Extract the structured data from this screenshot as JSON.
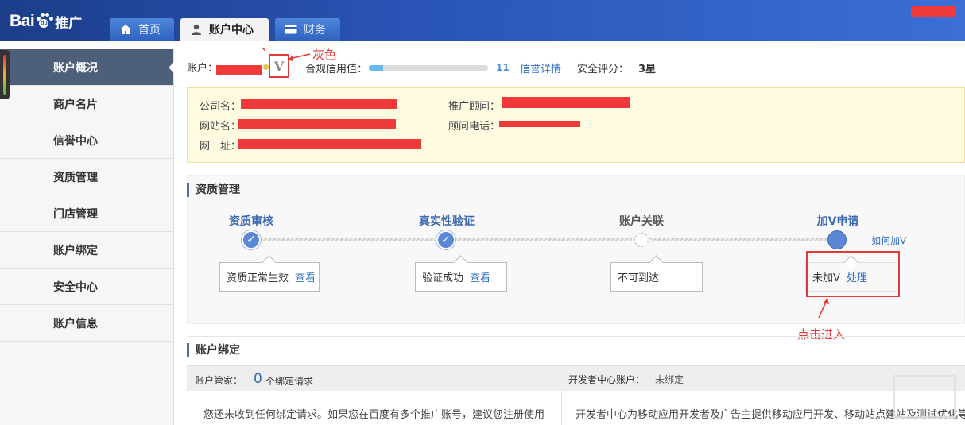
{
  "logo": {
    "bai": "Bai",
    "du": "du",
    "tuiguang": "推广"
  },
  "nav": {
    "tabs": [
      {
        "label": "首页",
        "icon": "home-icon"
      },
      {
        "label": "账户中心",
        "icon": "user-icon"
      },
      {
        "label": "财务",
        "icon": "card-icon"
      }
    ]
  },
  "sidebar": {
    "items": [
      {
        "label": "账户概况"
      },
      {
        "label": "商户名片"
      },
      {
        "label": "信誉中心"
      },
      {
        "label": "资质管理"
      },
      {
        "label": "门店管理"
      },
      {
        "label": "账户绑定"
      },
      {
        "label": "安全中心"
      },
      {
        "label": "账户信息"
      }
    ]
  },
  "account": {
    "label": "账户：",
    "v_badge": "V",
    "annotation_grey": "灰色",
    "credit_label": "合规信用值：",
    "credit_value": "11",
    "credit_fill": 0.12,
    "credit_link": "信誉详情",
    "safety_label": "安全评分：",
    "safety_value": "3星"
  },
  "info": {
    "company_label": "公司名：",
    "site_label": "网站名：",
    "url_label": "网　址：",
    "consultant_label": "推广顾问：",
    "phone_label": "顾问电话："
  },
  "qualification": {
    "title": "资质管理",
    "steps": [
      {
        "title": "资质审核",
        "status": "资质正常生效",
        "link": "查看"
      },
      {
        "title": "真实性验证",
        "status": "验证成功",
        "link": "查看"
      },
      {
        "title": "账户关联",
        "status": "不可到达",
        "link": ""
      },
      {
        "title": "加V申请",
        "status": "未加V",
        "link": "处理"
      }
    ],
    "how_to_v": "如何加V",
    "annotation_enter": "点击进入"
  },
  "binding": {
    "title": "账户绑定",
    "manager_label": "账户管家：",
    "request_count": "0",
    "request_text": "个绑定请求",
    "dev_label": "开发者中心账户：",
    "dev_value": "未绑定",
    "left_desc": "您还未收到任何绑定请求。如果您在百度有多个推广账号，建议您注册使用",
    "right_desc": "开发者中心为移动应用开发者及广告主提供移动应用开发、移动站点建站及测试优化等"
  },
  "colors": {
    "nav_bg": "#2a55b8",
    "sidebar_active": "#4e5f7a",
    "annotation": "#e23a3a",
    "link": "#2e6fc3",
    "step_blue": "#5b87d6"
  }
}
